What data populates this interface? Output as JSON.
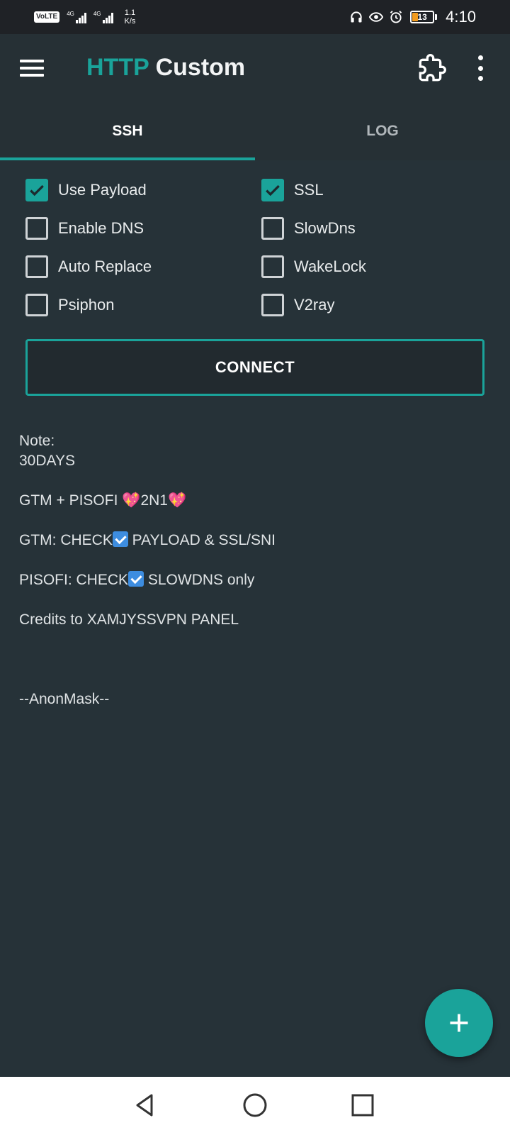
{
  "status_bar": {
    "volte": "VoLTE",
    "network_type_1": "4G",
    "network_type_2": "4G",
    "speed_value": "1.1",
    "speed_unit": "K/s",
    "battery": "13",
    "time": "4:10"
  },
  "app_bar": {
    "title_part1": "HTTP",
    "title_part2": "Custom"
  },
  "tabs": [
    {
      "label": "SSH",
      "active": true
    },
    {
      "label": "LOG",
      "active": false
    }
  ],
  "options": {
    "use_payload": {
      "label": "Use Payload",
      "checked": true
    },
    "ssl": {
      "label": "SSL",
      "checked": true
    },
    "enable_dns": {
      "label": "Enable DNS",
      "checked": false
    },
    "slowdns": {
      "label": "SlowDns",
      "checked": false
    },
    "auto_replace": {
      "label": "Auto Replace",
      "checked": false
    },
    "wakelock": {
      "label": "WakeLock",
      "checked": false
    },
    "psiphon": {
      "label": "Psiphon",
      "checked": false
    },
    "v2ray": {
      "label": "V2ray",
      "checked": false
    }
  },
  "connect_label": "CONNECT",
  "notes": {
    "line1": "Note:",
    "line2": "30DAYS",
    "line3_a": "GTM + PISOFI ",
    "line3_b": "2N1",
    "line4_a": "GTM: CHECK",
    "line4_b": " PAYLOAD & SSL/SNI",
    "line5_a": "PISOFI: CHECK",
    "line5_b": " SLOWDNS only",
    "line6": "Credits to XAMJYSSVPN PANEL",
    "line7": "--AnonMask--"
  },
  "colors": {
    "accent": "#1aa39a",
    "background": "#263238",
    "status_bar": "#1f2226",
    "nav_bar": "#ffffff"
  }
}
